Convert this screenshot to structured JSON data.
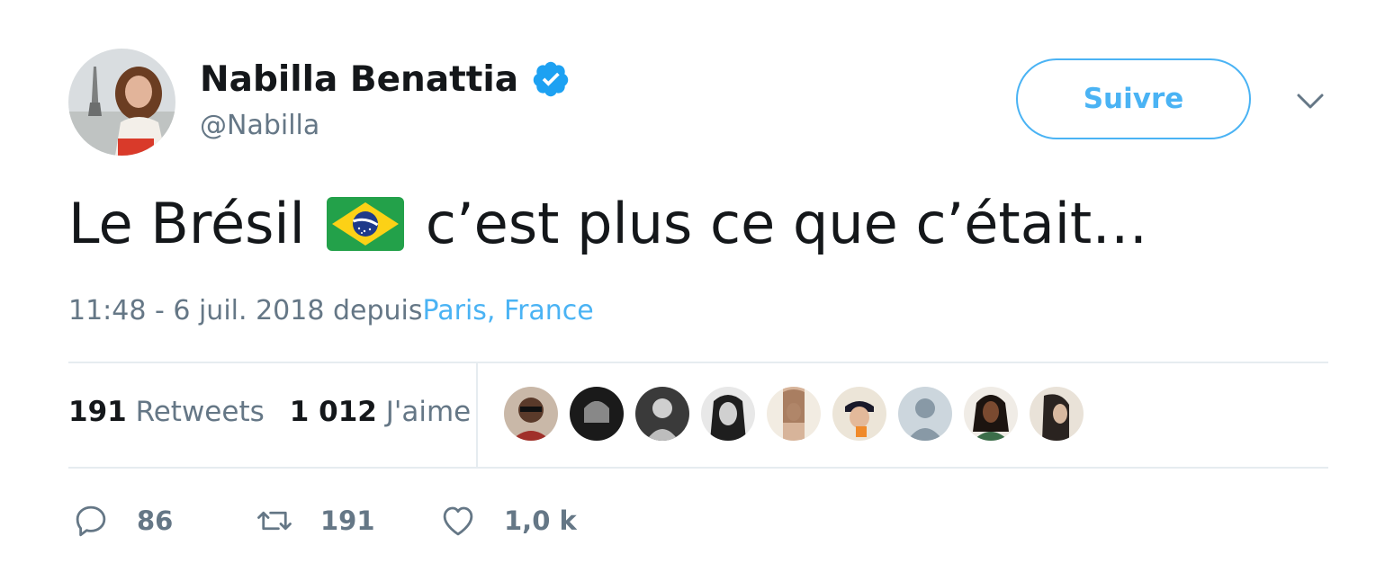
{
  "author": {
    "name": "Nabilla Benattia",
    "handle": "@Nabilla",
    "verified": true
  },
  "follow_button": {
    "label": "Suivre"
  },
  "tweet": {
    "text_before_flag": "Le Brésil",
    "flag_emoji": "brazil-flag-emoji",
    "text_after_flag": "c’est plus ce que c’était…",
    "timestamp": "11:48 - 6 juil. 2018",
    "via_label": "depuis",
    "location": "Paris, France"
  },
  "stats": {
    "retweets_count": "191",
    "retweets_label": "Retweets",
    "likes_count": "1 012",
    "likes_label": "J'aime"
  },
  "actions": {
    "reply_count": "86",
    "retweet_count": "191",
    "like_count": "1,0 k"
  },
  "colors": {
    "accent": "#4ab3f4",
    "text_primary": "#14171a",
    "text_secondary": "#657786",
    "divider": "#e6ecf0",
    "verified_badge": "#1da1f2"
  }
}
